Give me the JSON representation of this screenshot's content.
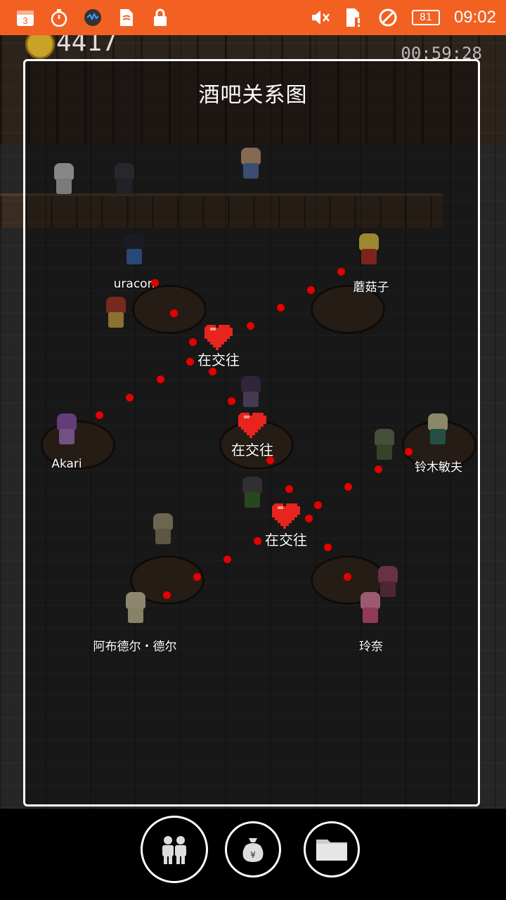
{
  "status_bar": {
    "calendar_day": "3",
    "battery": "81",
    "time": "09:02",
    "icons_left": [
      "calendar-icon",
      "stopwatch-icon",
      "app-icon",
      "sim-icon",
      "lock-icon"
    ],
    "icons_right": [
      "mute-icon",
      "sim-alert-icon",
      "no-signal-icon",
      "battery-icon"
    ]
  },
  "game": {
    "gold": "4417",
    "timer": "00:59:28",
    "panel_title": "酒吧关系图",
    "characters": [
      {
        "name": "uracon"
      },
      {
        "name": "蘑菇子"
      },
      {
        "name": "Akari"
      },
      {
        "name": "铃木敏夫"
      },
      {
        "name": "阿布德尔・德尔"
      },
      {
        "name": "玲奈"
      }
    ],
    "relations": [
      {
        "label": "在交往"
      },
      {
        "label": "在交往"
      },
      {
        "label": "在交往"
      }
    ]
  },
  "bottom_buttons": [
    {
      "icon": "people-icon"
    },
    {
      "icon": "money-bag-icon"
    },
    {
      "icon": "folder-icon"
    }
  ],
  "colors": {
    "status_bar": "#f26122",
    "relation_dot": "#e60000",
    "heart": "#e8241e"
  }
}
